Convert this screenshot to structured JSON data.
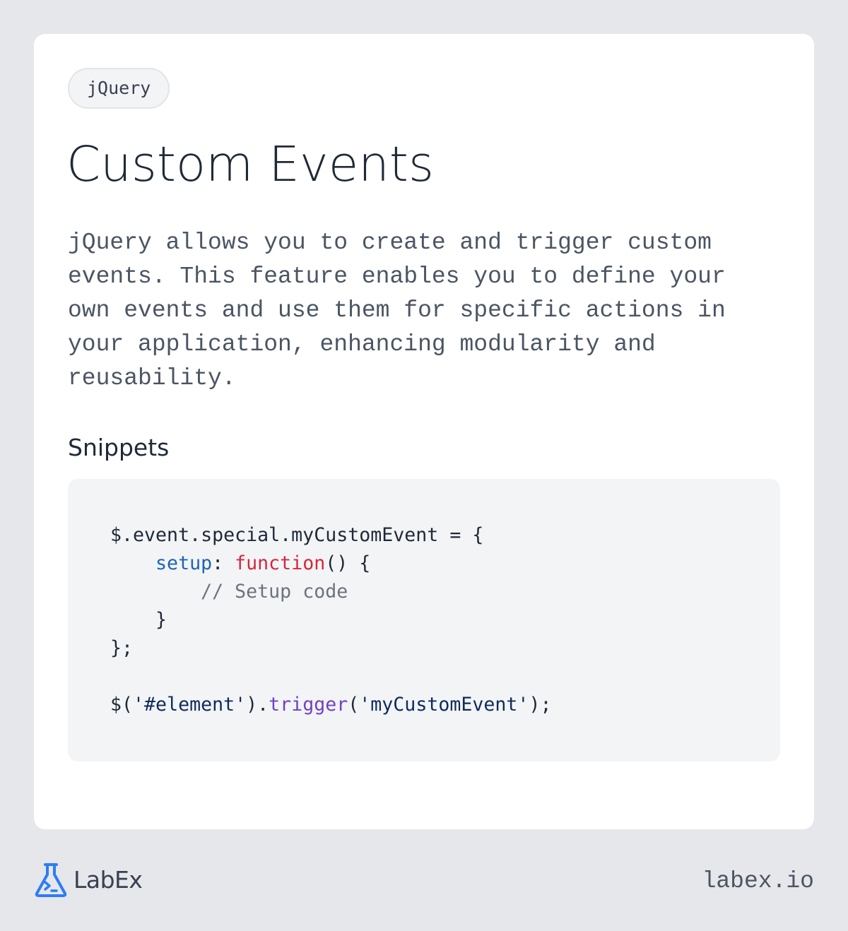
{
  "card": {
    "tag": "jQuery",
    "title": "Custom Events",
    "description": "jQuery allows you to create and trigger custom events. This feature enables you to define your own events and use them for specific actions in your application, enhancing modularity and reusability.",
    "section_title": "Snippets",
    "code": {
      "line1": "$.event.special.myCustomEvent = {",
      "line2_indent": "    ",
      "line2_prop": "setup",
      "line2_colon": ": ",
      "line2_kw": "function",
      "line2_rest": "() {",
      "line3_indent": "        ",
      "line3_comment": "// Setup code",
      "line4": "    }",
      "line5": "};",
      "line7_a": "$(",
      "line7_str1": "'#element'",
      "line7_b": ").",
      "line7_method": "trigger",
      "line7_c": "(",
      "line7_str2": "'myCustomEvent'",
      "line7_d": ");"
    }
  },
  "footer": {
    "brand": "LabEx",
    "domain": "labex.io",
    "brand_color": "#2e7cf6"
  }
}
